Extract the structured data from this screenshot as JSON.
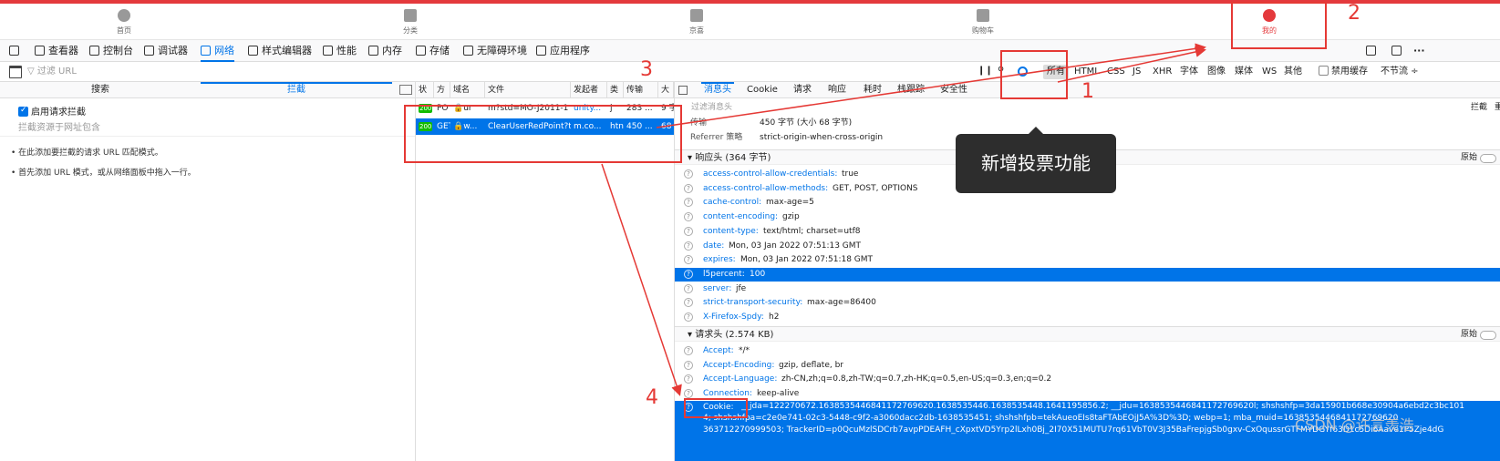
{
  "mobile_nav": {
    "items": [
      {
        "label": "首页"
      },
      {
        "label": "分类"
      },
      {
        "label": "京喜"
      },
      {
        "label": "购物车"
      },
      {
        "label": "我的"
      }
    ]
  },
  "devtools_tabs": [
    {
      "label": "查看器",
      "icon": "inspector-icon"
    },
    {
      "label": "控制台",
      "icon": "console-icon"
    },
    {
      "label": "调试器",
      "icon": "debugger-icon"
    },
    {
      "label": "网络",
      "icon": "network-icon"
    },
    {
      "label": "样式编辑器",
      "icon": "style-editor-icon"
    },
    {
      "label": "性能",
      "icon": "performance-icon"
    },
    {
      "label": "内存",
      "icon": "memory-icon"
    },
    {
      "label": "存储",
      "icon": "storage-icon"
    },
    {
      "label": "无障碍环境",
      "icon": "accessibility-icon"
    },
    {
      "label": "应用程序",
      "icon": "application-icon"
    }
  ],
  "filter": {
    "placeholder": "过滤 URL",
    "types": [
      "所有",
      "HTML",
      "CSS",
      "JS",
      "XHR",
      "字体",
      "图像",
      "媒体",
      "WS",
      "其他"
    ],
    "disable_cache": "禁用缓存",
    "throttle": "不节流 ÷"
  },
  "left_panel": {
    "tabs": [
      "搜索",
      "拦截"
    ],
    "enable_label": "启用请求拦截",
    "input_placeholder": "拦截资源于网址包含",
    "tips": [
      "• 在此添加要拦截的请求 URL 匹配模式。",
      "• 首先添加 URL 模式，或从网络面板中拖入一行。"
    ]
  },
  "request_list": {
    "columns": [
      "状",
      "方",
      "域名",
      "文件",
      "发起者",
      "类",
      "传输",
      "大"
    ],
    "rows": [
      {
        "status": "200",
        "method": "PO",
        "domain": "ur",
        "file": "m?std=MO-J2011-1",
        "initiator": "unity...",
        "type": "j",
        "transfer": "283 ...",
        "size": "9 字"
      },
      {
        "status": "200",
        "method": "GET",
        "domain": "w...",
        "file": "ClearUserRedPoint?t",
        "initiator": "m.co...",
        "type": "htn",
        "transfer": "450 ...",
        "size": "68"
      }
    ]
  },
  "detail": {
    "tabs": [
      "消息头",
      "Cookie",
      "请求",
      "响应",
      "耗时",
      "栈跟踪",
      "安全性"
    ],
    "filter_placeholder": "过滤消息头",
    "intercept": "拦截",
    "resend": "重发",
    "summary": [
      {
        "key": "传输",
        "value": "450 字节 (大小 68 字节)"
      },
      {
        "key": "Referrer 策略",
        "value": "strict-origin-when-cross-origin"
      }
    ],
    "response_section": "响应头 (364 字节)",
    "raw_label": "原始",
    "response_headers": [
      {
        "key": "access-control-allow-credentials:",
        "value": "true"
      },
      {
        "key": "access-control-allow-methods:",
        "value": "GET, POST, OPTIONS"
      },
      {
        "key": "cache-control:",
        "value": "max-age=5"
      },
      {
        "key": "content-encoding:",
        "value": "gzip"
      },
      {
        "key": "content-type:",
        "value": "text/html; charset=utf8"
      },
      {
        "key": "date:",
        "value": "Mon, 03 Jan 2022 07:51:13 GMT"
      },
      {
        "key": "expires:",
        "value": "Mon, 03 Jan 2022 07:51:18 GMT"
      },
      {
        "key": "l5percent:",
        "value": "100"
      },
      {
        "key": "server:",
        "value": "jfe"
      },
      {
        "key": "strict-transport-security:",
        "value": "max-age=86400"
      },
      {
        "key": "X-Firefox-Spdy:",
        "value": "h2"
      }
    ],
    "request_section": "请求头 (2.574 KB)",
    "request_headers": [
      {
        "key": "Accept:",
        "value": "*/*"
      },
      {
        "key": "Accept-Encoding:",
        "value": "gzip, deflate, br"
      },
      {
        "key": "Accept-Language:",
        "value": "zh-CN,zh;q=0.8,zh-TW;q=0.7,zh-HK;q=0.5,en-US;q=0.3,en;q=0.2"
      },
      {
        "key": "Connection:",
        "value": "keep-alive"
      }
    ],
    "cookie_key": "Cookie:",
    "cookie_lines": [
      "__jda=122270672.1638535446841172769620.1638535446.1638535448.1641195856.2; __jdu=1638535446841172769620l; shshshfp=3da15901b668e30904a6ebd2c3bc101",
      "4; shshshfpa=c2e0e741-02c3-5448-c9f2-a3060dacc2db-1638535451; shshshfpb=tekAueoEIs8taFTAbEOjJ5A%3D%3D; webp=1; mba_muid=1638535446841172769620",
      "363712270999503; TrackerID=p0QcuMzlSDCrb7avpPDEAFH_cXpxtVD5Yrp2lLxh0Bj_2I70X51MUTU7rq61VbT0V3J35BaFrepjgSb0gxv-CxOqussrGTFMYDGYf63D1c5Di6Aave1P5Zje4dG"
    ]
  },
  "annotations": {
    "tooltip": "新增投票功能",
    "numbers": [
      "1",
      "2",
      "3",
      "4"
    ],
    "color": "#e53935"
  },
  "watermark": "CSDN @许言羡浩"
}
